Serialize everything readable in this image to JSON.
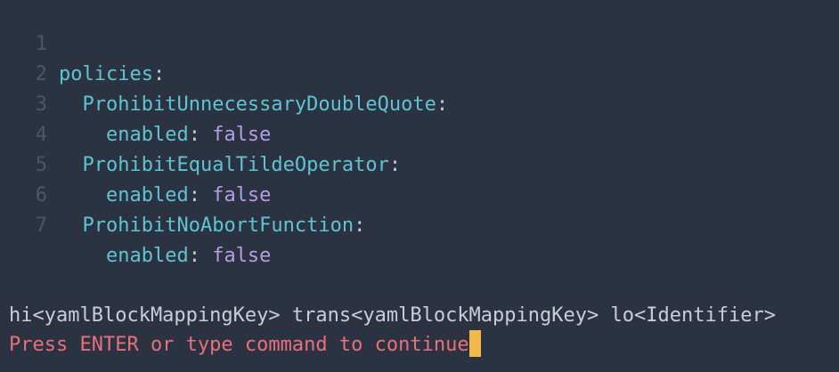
{
  "colors": {
    "background": "#2b3342",
    "line_number": "#4e5666",
    "key": "#5fc4d1",
    "value": "#b89ce0",
    "text": "#c8cdd6",
    "prompt": "#e8707a",
    "cursor": "#f2b84b"
  },
  "editor": {
    "lines": [
      {
        "num": "1",
        "indent": "",
        "key": "policies",
        "colon": ":",
        "value": ""
      },
      {
        "num": "2",
        "indent": "  ",
        "key": "ProhibitUnnecessaryDoubleQuote",
        "colon": ":",
        "value": ""
      },
      {
        "num": "3",
        "indent": "    ",
        "key": "enabled",
        "colon": ":",
        "value": " false"
      },
      {
        "num": "4",
        "indent": "  ",
        "key": "ProhibitEqualTildeOperator",
        "colon": ":",
        "value": ""
      },
      {
        "num": "5",
        "indent": "    ",
        "key": "enabled",
        "colon": ":",
        "value": " false"
      },
      {
        "num": "6",
        "indent": "  ",
        "key": "ProhibitNoAbortFunction",
        "colon": ":",
        "value": ""
      },
      {
        "num": "7",
        "indent": "    ",
        "key": "enabled",
        "colon": ":",
        "value": " false"
      }
    ]
  },
  "status_line": "hi<yamlBlockMappingKey> trans<yamlBlockMappingKey> lo<Identifier>",
  "prompt_line": "Press ENTER or type command to continue"
}
